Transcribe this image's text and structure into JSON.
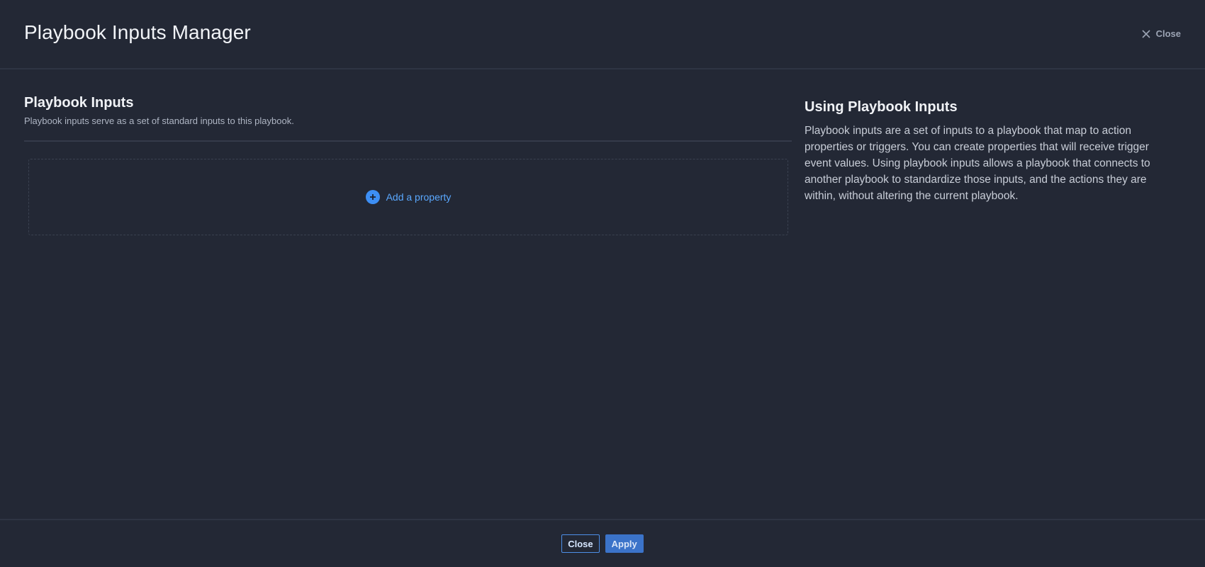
{
  "header": {
    "title": "Playbook Inputs Manager",
    "close_label": "Close"
  },
  "inputs": {
    "title": "Playbook Inputs",
    "subtitle": "Playbook inputs serve as a set of standard inputs to this playbook.",
    "add_property_label": "Add a property"
  },
  "help": {
    "title": "Using Playbook Inputs",
    "body": "Playbook inputs are a set of inputs to a playbook that map to action properties or triggers. You can create properties that will receive trigger event values. Using playbook inputs allows a playbook that connects to another playbook to standardize those inputs, and the actions they are within, without altering the current playbook."
  },
  "footer": {
    "close_label": "Close",
    "apply_label": "Apply"
  },
  "colors": {
    "background": "#232835",
    "accent": "#3d8ff5",
    "link": "#5aa8ff"
  }
}
